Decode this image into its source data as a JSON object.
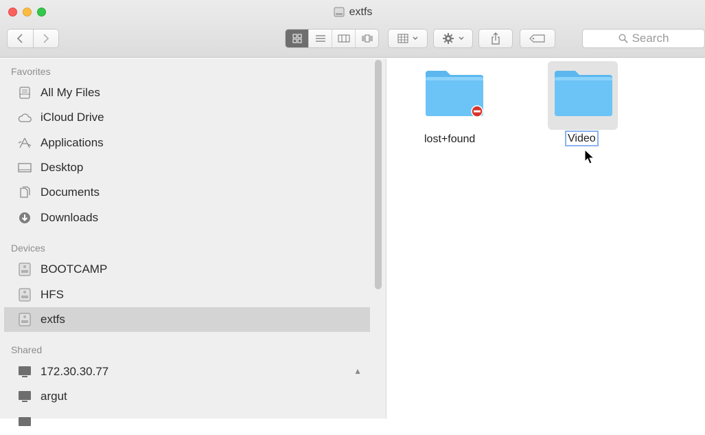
{
  "window": {
    "title": "extfs"
  },
  "toolbar": {
    "search_placeholder": "Search"
  },
  "sidebar": {
    "favorites_title": "Favorites",
    "favorites": [
      {
        "label": "All My Files",
        "icon": "all-files-icon"
      },
      {
        "label": "iCloud Drive",
        "icon": "cloud-icon"
      },
      {
        "label": "Applications",
        "icon": "applications-icon"
      },
      {
        "label": "Desktop",
        "icon": "desktop-icon"
      },
      {
        "label": "Documents",
        "icon": "documents-icon"
      },
      {
        "label": "Downloads",
        "icon": "downloads-icon"
      }
    ],
    "devices_title": "Devices",
    "devices": [
      {
        "label": "BOOTCAMP",
        "icon": "drive-icon"
      },
      {
        "label": "HFS",
        "icon": "drive-icon"
      },
      {
        "label": "extfs",
        "icon": "drive-icon",
        "selected": true
      }
    ],
    "shared_title": "Shared",
    "shared": [
      {
        "label": "172.30.30.77",
        "icon": "computer-icon"
      },
      {
        "label": "argut",
        "icon": "computer-icon"
      }
    ]
  },
  "content": {
    "items": [
      {
        "name": "lost+found",
        "icon": "folder-no-access-icon"
      },
      {
        "name": "Video",
        "icon": "folder-icon",
        "selected": true,
        "renaming": true
      }
    ]
  },
  "colors": {
    "folder": "#6cc4f6",
    "folder_dark": "#5bb7ee",
    "selection_sidebar": "#d4d4d4",
    "rename_border": "#8ab2ee",
    "no_access_badge": "#d9322a"
  }
}
